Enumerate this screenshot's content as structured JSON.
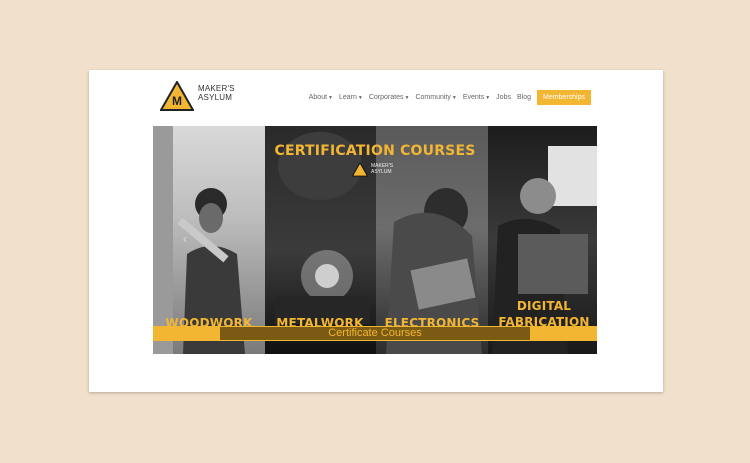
{
  "brand": {
    "line1": "MAKER'S",
    "line2": "ASYLUM",
    "mark": "M"
  },
  "nav": {
    "items": [
      {
        "label": "About",
        "dropdown": true
      },
      {
        "label": "Learn",
        "dropdown": true
      },
      {
        "label": "Corporates",
        "dropdown": true
      },
      {
        "label": "Community",
        "dropdown": true
      },
      {
        "label": "Events",
        "dropdown": true
      },
      {
        "label": "Jobs",
        "dropdown": false
      },
      {
        "label": "Blog",
        "dropdown": false
      }
    ],
    "cta": "Memberships"
  },
  "hero": {
    "title": "CERTIFICATION COURSES",
    "logo_line1": "MAKER'S",
    "logo_line2": "ASYLUM",
    "panels": [
      "WOODWORK",
      "METALWORK",
      "ELECTRONICS",
      "DIGITAL FABRICATION"
    ],
    "banner": "Certificate Courses",
    "arrow_icon": "chevron-left-icon"
  },
  "colors": {
    "accent": "#f3b632",
    "background": "#f1e0cb",
    "card": "#ffffff"
  }
}
